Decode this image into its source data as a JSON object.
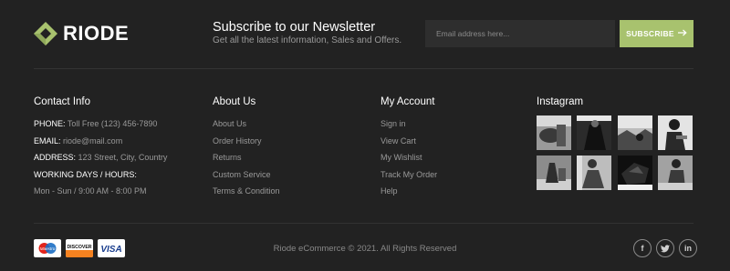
{
  "brand": {
    "name": "RIODE",
    "accent_color": "#a8c26e",
    "logo_icon": "diamond-logo-icon"
  },
  "newsletter": {
    "title": "Subscribe to our Newsletter",
    "subtitle": "Get all the latest information, Sales and Offers.",
    "email_placeholder": "Email address here...",
    "subscribe_label": "SUBSCRIBE",
    "subscribe_icon": "arrow-right-icon"
  },
  "contact": {
    "title": "Contact Info",
    "phone_label": "PHONE:",
    "phone_value": "Toll Free (123) 456-7890",
    "email_label": "EMAIL:",
    "email_value": "riode@mail.com",
    "address_label": "ADDRESS:",
    "address_value": "123 Street, City, Country",
    "hours_label": "WORKING DAYS / HOURS:",
    "hours_value": "Mon - Sun / 9:00 AM - 8:00 PM"
  },
  "about": {
    "title": "About Us",
    "links": [
      "About Us",
      "Order History",
      "Returns",
      "Custom Service",
      "Terms & Condition"
    ]
  },
  "account": {
    "title": "My Account",
    "links": [
      "Sign in",
      "View Cart",
      "My Wishlist",
      "Track My Order",
      "Help"
    ]
  },
  "instagram": {
    "title": "Instagram",
    "image_count": 8
  },
  "footer": {
    "payment_icons": [
      "maestro-icon",
      "discover-icon",
      "visa-icon"
    ],
    "payment_labels": {
      "maestro": "Maestro",
      "discover": "DISCOVER",
      "visa": "VISA"
    },
    "copyright": "Riode eCommerce © 2021. All Rights Reserved",
    "social_icons": [
      "facebook-icon",
      "twitter-icon",
      "linkedin-icon"
    ],
    "social_glyphs": {
      "facebook": "f",
      "twitter": "t",
      "linkedin": "in"
    }
  }
}
